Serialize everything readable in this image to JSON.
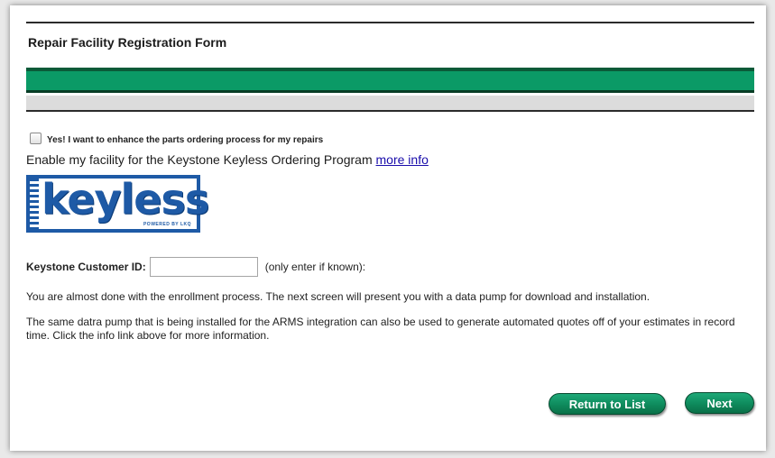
{
  "form": {
    "title": "Repair Facility Registration Form"
  },
  "keyless": {
    "checkbox_label": "Yes!  I want to enhance the parts ordering process for my repairs",
    "checkbox_checked": false,
    "enable_text": "Enable my facility for the Keystone Keyless Ordering Program ",
    "more_info_link": "more info",
    "logo_text": "keyless",
    "logo_subtext": "POWERED BY LKQ"
  },
  "customer": {
    "label": "Keystone Customer ID:",
    "value": "",
    "hint": "(only enter if known):"
  },
  "paragraphs": {
    "p1": "You are almost done with the enrollment process. The next screen will present you with a data pump for download and installation.",
    "p2": "The same datra pump that is being installed for the ARMS integration can also be used to generate automated quotes off of your estimates in record time.  Click the info link above for more information."
  },
  "buttons": {
    "return_label": "Return to List",
    "next_label": "Next"
  },
  "colors": {
    "accent_green": "#0b9a66",
    "link_blue": "#1a0dab",
    "logo_blue": "#1e5aa6"
  }
}
